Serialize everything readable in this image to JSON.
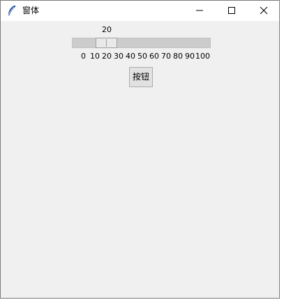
{
  "window": {
    "title": "窗体",
    "icon": "feather-icon",
    "controls": [
      "minimize-icon",
      "maximize-icon",
      "close-icon"
    ]
  },
  "scale": {
    "value": "20",
    "current": 20,
    "min": 0,
    "max": 100,
    "ticks": [
      "0",
      "10",
      "20",
      "30",
      "40",
      "50",
      "60",
      "70",
      "80",
      "90",
      "100"
    ]
  },
  "button": {
    "label": "按钮"
  }
}
